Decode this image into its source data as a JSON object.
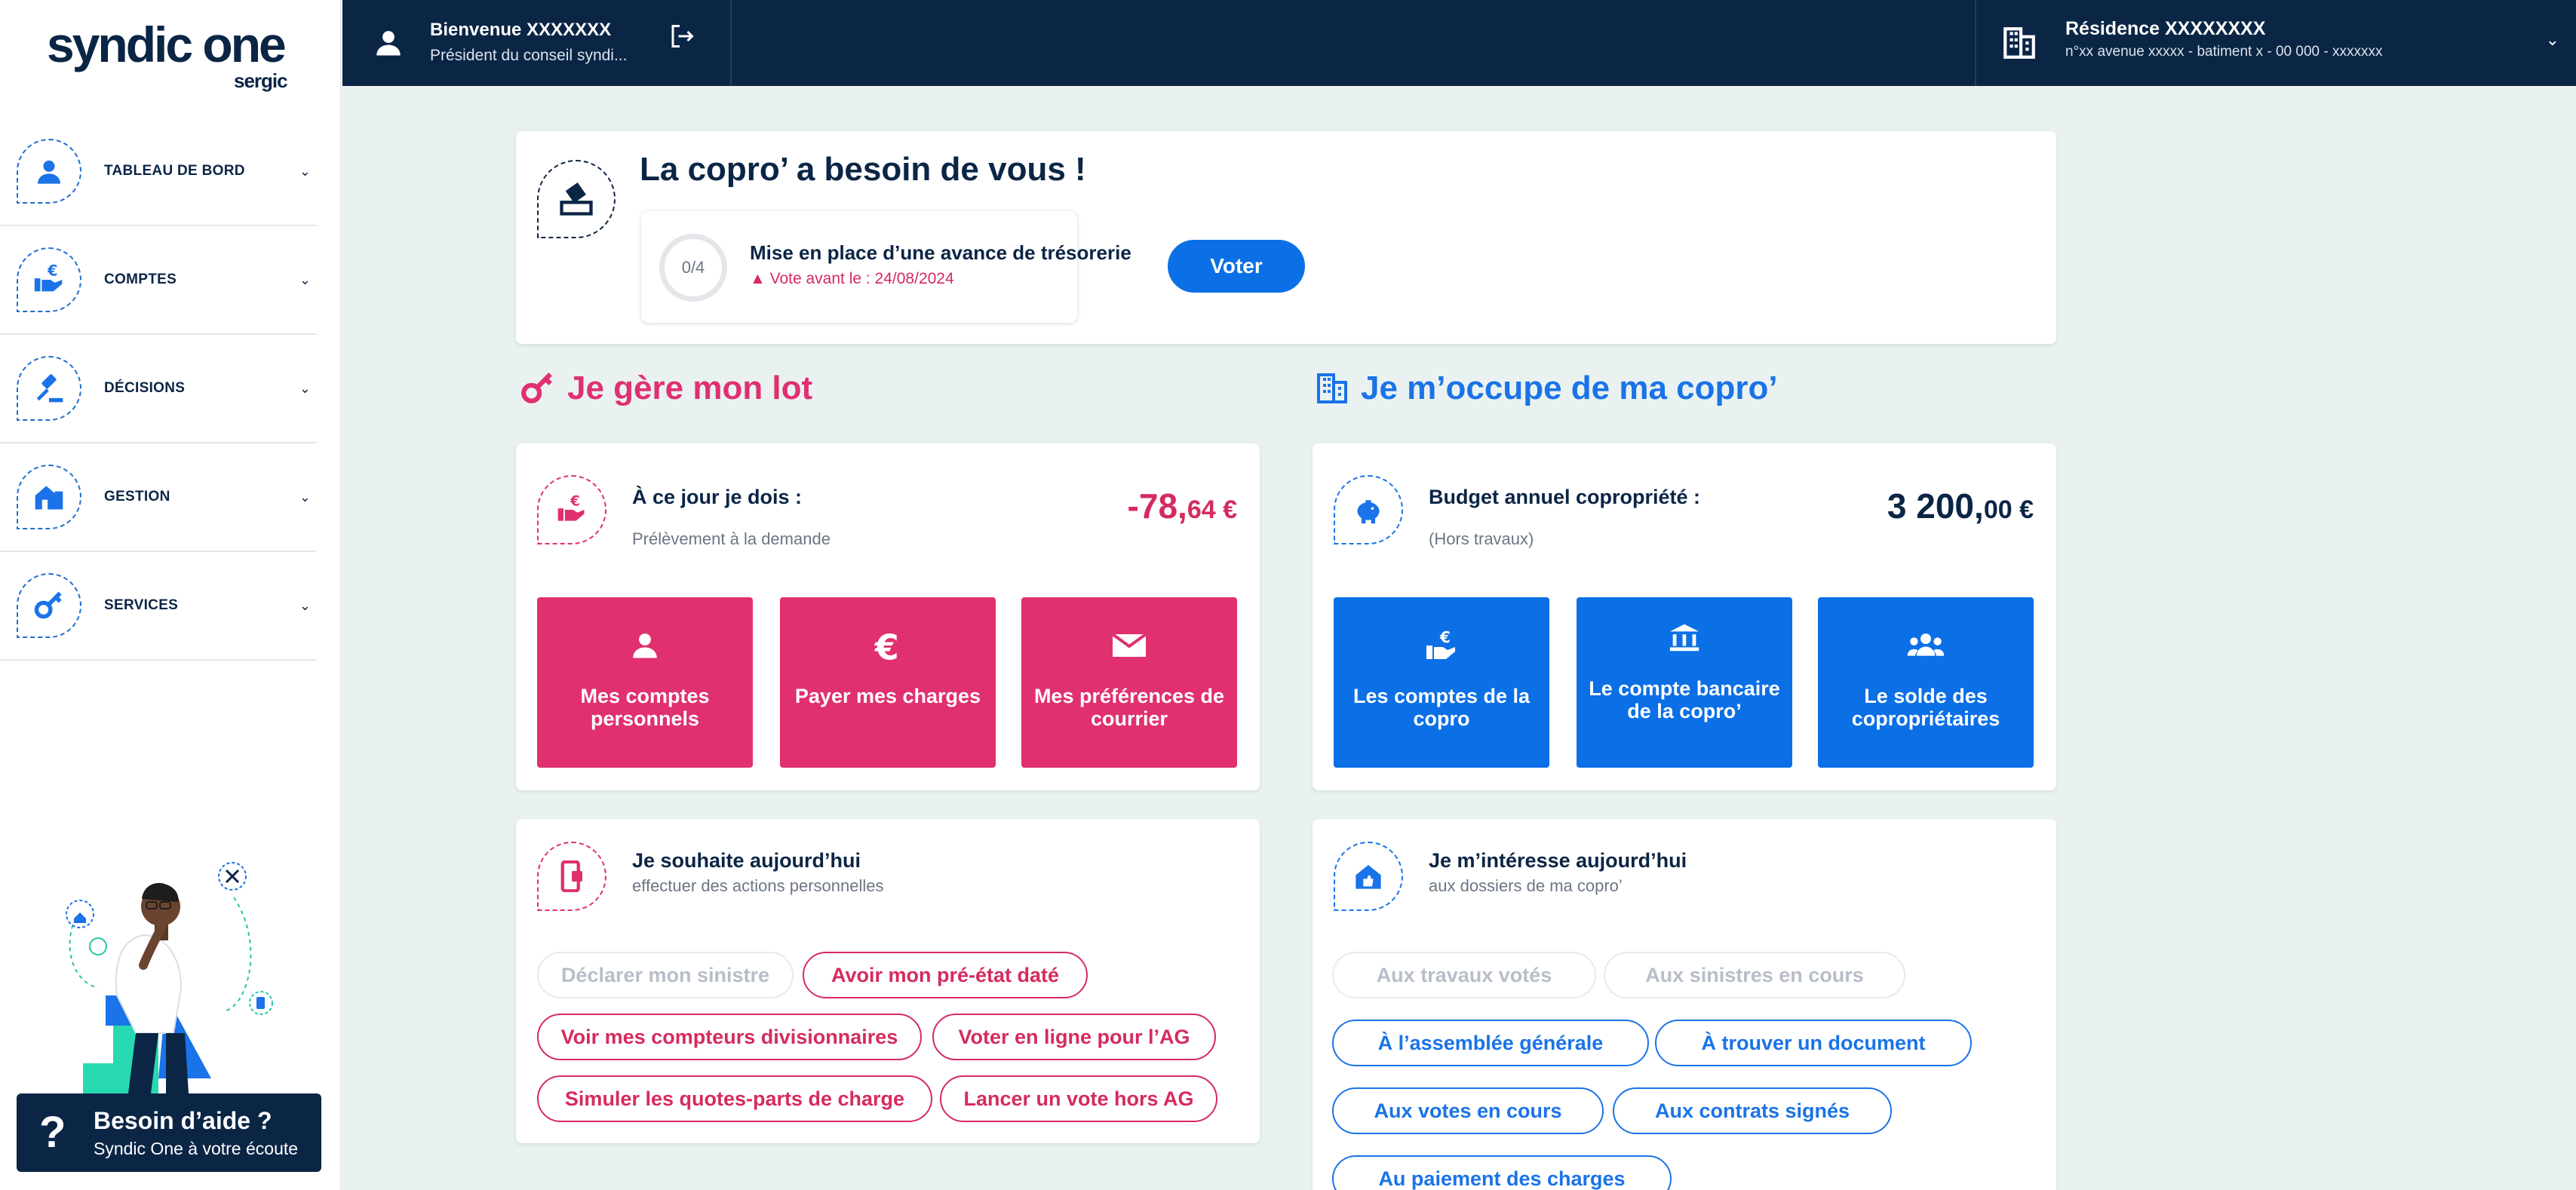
{
  "sidebar": {
    "logo_name": "syndic one",
    "logo_sub": "sergic",
    "nav": [
      {
        "label": "TABLEAU DE BORD",
        "icon": "user-icon"
      },
      {
        "label": "COMPTES",
        "icon": "euro-hand-icon"
      },
      {
        "label": "DÉCISIONS",
        "icon": "gavel-icon"
      },
      {
        "label": "GESTION",
        "icon": "house-icon"
      },
      {
        "label": "SERVICES",
        "icon": "key-icon"
      }
    ],
    "help": {
      "symbol": "?",
      "title": "Besoin d’aide ?",
      "subtitle": "Syndic One à votre écoute"
    }
  },
  "topbar": {
    "welcome": "Bienvenue XXXXXXX",
    "role": "Président du conseil syndi...",
    "residence_name": "Résidence XXXXXXXX",
    "residence_address": "n°xx avenue xxxxx - batiment x - 00 000 - xxxxxxx"
  },
  "vote": {
    "title": "La copro’ a besoin de vous !",
    "progress": "0/4",
    "progress_fraction": 0,
    "item_label": "Mise en place d’une avance de trésorerie",
    "deadline": "Vote avant le : 24/08/2024",
    "button": "Voter"
  },
  "lot": {
    "section_title": "Je gère mon lot",
    "summary_label": "À ce jour je dois :",
    "summary_sub": "Prélèvement à la demande",
    "amount_int": "-78,",
    "amount_dec": "64 €",
    "tiles": [
      {
        "label": "Mes comptes personnels",
        "icon": "user-icon"
      },
      {
        "label": "Payer mes charges",
        "icon": "euro-icon"
      },
      {
        "label": "Mes préférences de courrier",
        "icon": "mail-icon"
      }
    ],
    "wish_title": "Je souhaite aujourd’hui",
    "wish_sub": "effectuer des actions personnelles",
    "chips": [
      {
        "label": "Déclarer mon sinistre",
        "disabled": true
      },
      {
        "label": "Avoir mon pré-état daté",
        "disabled": false
      },
      {
        "label": "Voir mes compteurs divisionnaires",
        "disabled": false
      },
      {
        "label": "Voter en ligne pour l’AG",
        "disabled": false
      },
      {
        "label": "Simuler les quotes-parts de charge",
        "disabled": false
      },
      {
        "label": "Lancer un vote hors AG",
        "disabled": false
      }
    ]
  },
  "copro": {
    "section_title": "Je m’occupe de ma copro’",
    "summary_label": "Budget annuel copropriété :",
    "summary_sub": "(Hors travaux)",
    "amount_int": "3 200,",
    "amount_dec": "00 €",
    "tiles": [
      {
        "label": "Les comptes de la copro",
        "icon": "euro-hand-icon"
      },
      {
        "label": "Le compte bancaire de la copro’",
        "icon": "bank-icon"
      },
      {
        "label": "Le solde des copropriétaires",
        "icon": "group-icon"
      }
    ],
    "interest_title": "Je m’intéresse aujourd’hui",
    "interest_sub": "aux dossiers de ma copro’",
    "chips": [
      {
        "label": "Aux travaux votés",
        "disabled": true
      },
      {
        "label": "Aux sinistres en cours",
        "disabled": true
      },
      {
        "label": "À l’assemblée générale",
        "disabled": false
      },
      {
        "label": "À trouver un document",
        "disabled": false
      },
      {
        "label": "Aux votes en cours",
        "disabled": false
      },
      {
        "label": "Aux contrats signés",
        "disabled": false
      },
      {
        "label": "Au paiement des charges",
        "disabled": false
      }
    ]
  },
  "colors": {
    "navy": "#0b2545",
    "pink": "#e0306f",
    "blue": "#0b6fe6",
    "background": "#eaf2f1"
  }
}
